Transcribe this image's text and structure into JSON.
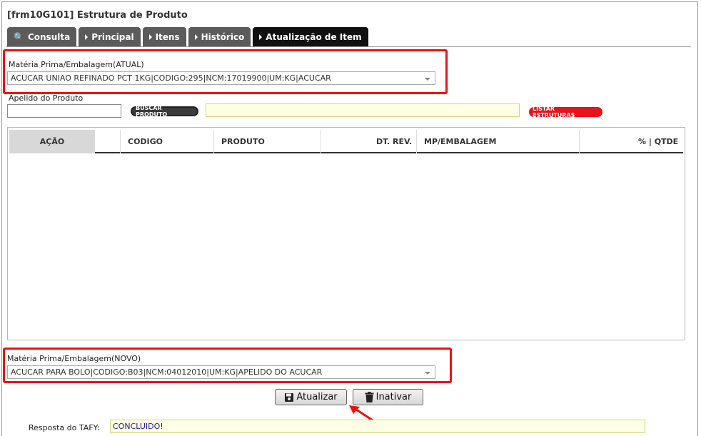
{
  "window": {
    "title": "[frm10G101] Estrutura de Produto"
  },
  "tabs": [
    {
      "label": "Consulta",
      "icon": "magnifier-icon"
    },
    {
      "label": "Principal",
      "icon": "arrow-right-icon"
    },
    {
      "label": "Itens",
      "icon": "arrow-right-icon"
    },
    {
      "label": "Histórico",
      "icon": "arrow-right-icon"
    },
    {
      "label": "Atualização de Item",
      "icon": "arrow-right-icon",
      "active": true
    }
  ],
  "materia_atual": {
    "label": "Matéria Prima/Embalagem(ATUAL)",
    "value": "ACUCAR UNIAO REFINADO PCT 1KG|CODIGO:295|NCM:17019900|UM:KG|ACUCAR"
  },
  "apelido": {
    "label": "Apelido do Produto",
    "value": "",
    "buscar_label": "BUSCAR PRODUTO",
    "listar_label": "LISTAR ESTRUTURAS"
  },
  "grid": {
    "columns": [
      "AÇÃO",
      "CODIGO",
      "PRODUTO",
      "DT. REV.",
      "MP/EMBALAGEM",
      "% | QTDE"
    ],
    "rows": []
  },
  "materia_novo": {
    "label": "Matéria Prima/Embalagem(NOVO)",
    "value": "ACUCAR PARA BOLO|CODIGO:B03|NCM:04012010|UM:KG|APELIDO DO ACUCAR"
  },
  "actions": {
    "atualizar_label": "Atualizar",
    "inativar_label": "Inativar"
  },
  "resposta": {
    "label": "Resposta do TAFY:",
    "value": "CONCLUIDO!"
  },
  "colors": {
    "highlight": "#e11111",
    "tab_active": "#111111",
    "tab": "#5b5b5b"
  }
}
